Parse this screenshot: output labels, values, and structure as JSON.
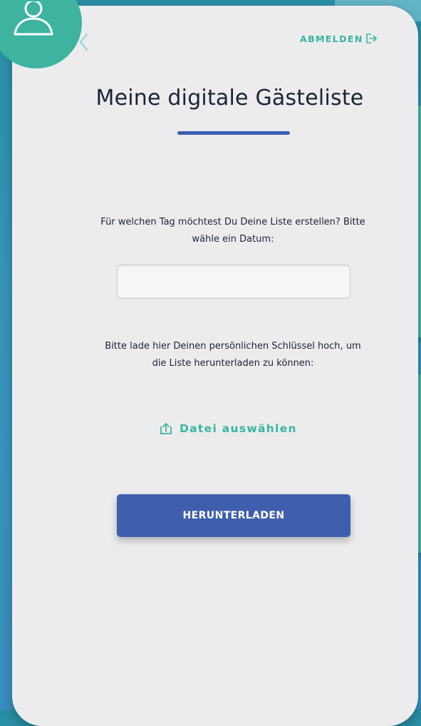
{
  "header": {
    "logout_label": "ABMELDEN"
  },
  "main": {
    "title": "Meine digitale Gästeliste",
    "date_prompt": "Für welchen Tag möchtest Du Deine Liste erstellen? Bitte wähle ein Datum:",
    "date_input": {
      "value": "",
      "placeholder": ""
    },
    "key_prompt": "Bitte lade hier Deinen persönlichen Schlüssel hoch, um die Liste herunterladen zu können:",
    "file_select_label": "Datei auswählen",
    "download_label": "HERUNTERLADEN"
  },
  "icons": {
    "avatar": "user-icon",
    "back": "chevron-left-icon",
    "logout": "logout-icon",
    "upload": "upload-icon"
  },
  "colors": {
    "accent_teal": "#3ab59d",
    "primary_blue": "#3f5fad",
    "title_text": "#1c2433",
    "panel_bg": "#ececef",
    "page_bg": "#3596b9"
  }
}
